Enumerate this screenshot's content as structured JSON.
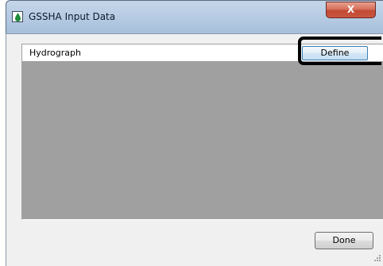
{
  "window": {
    "title": "GSSHA Input Data",
    "close_label": "X"
  },
  "grid": {
    "row_label": "Hydrograph",
    "define_label": "Define"
  },
  "footer": {
    "done_label": "Done"
  },
  "icons": {
    "app": "water-drop-icon",
    "close": "close-icon",
    "grip": "resize-grip-icon"
  },
  "colors": {
    "grid_background": "#a0a0a0",
    "close_button": "#c24a36",
    "highlight_outline": "#000000"
  }
}
